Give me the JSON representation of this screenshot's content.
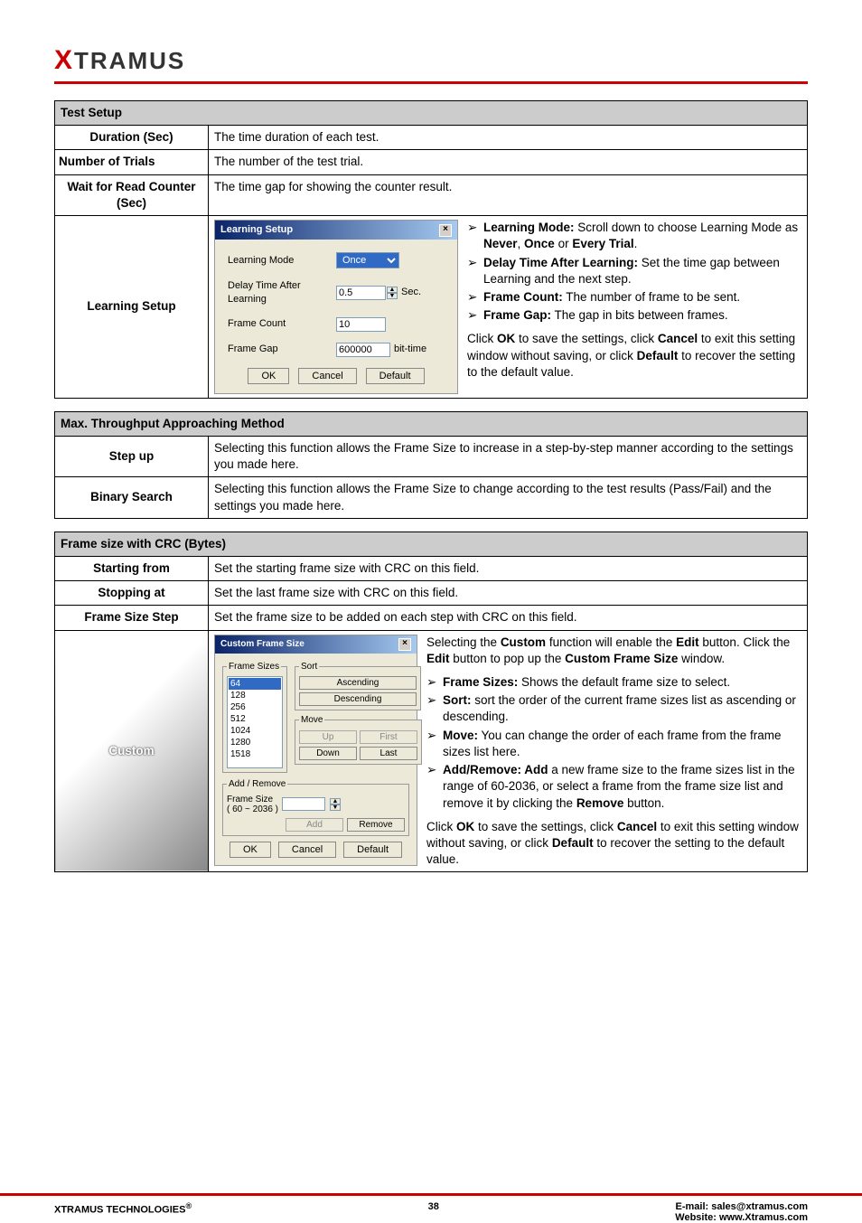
{
  "brand": {
    "x": "X",
    "rest": "TRAMUS"
  },
  "table1": {
    "header": "Test Setup",
    "rows": [
      {
        "label": "Duration (Sec)",
        "desc": "The time duration of each test."
      },
      {
        "label": "Number of Trials",
        "desc": "The number of the test trial."
      },
      {
        "label": "Wait for Read Counter (Sec)",
        "desc": "The time gap for showing the counter result."
      }
    ],
    "learning": {
      "label": "Learning Setup",
      "dialog": {
        "title": "Learning Setup",
        "r1lbl": "Learning Mode",
        "r1val": "Once",
        "r2lbl": "Delay Time After Learning",
        "r2val": "0.5",
        "r2unit": "Sec.",
        "r3lbl": "Frame Count",
        "r3val": "10",
        "r4lbl": "Frame Gap",
        "r4val": "600000",
        "r4unit": "bit-time",
        "btnOK": "OK",
        "btnCancel": "Cancel",
        "btnDefault": "Default"
      },
      "desc": {
        "b1a": "Learning Mode:",
        "b1b": " Scroll down to choose Learning Mode as ",
        "b1c": "Never",
        "b1d": ", ",
        "b1e": "Once",
        "b1f": " or ",
        "b1g": "Every Trial",
        "b1h": ".",
        "b2a": "Delay Time After Learning:",
        "b2b": " Set the time gap between Learning and the next step.",
        "b3a": "Frame Count:",
        "b3b": " The number of frame to be sent.",
        "b4a": "Frame Gap:",
        "b4b": " The gap in bits between frames.",
        "tail1": "Click ",
        "tail2": "OK",
        "tail3": " to save the settings, click ",
        "tail4": "Cancel",
        "tail5": " to exit this setting window without saving, or click ",
        "tail6": "Default",
        "tail7": " to recover the setting to the default value."
      }
    }
  },
  "table2": {
    "header": "Max. Throughput Approaching Method",
    "r1lbl": "Step up",
    "r1desc": "Selecting this function allows the Frame Size to increase in a step-by-step manner according to the settings you made here.",
    "r2lbl": "Binary Search",
    "r2desc": "Selecting this function allows the Frame Size to change according to the test results (Pass/Fail) and the settings you made here."
  },
  "table3": {
    "header": "Frame size with CRC (Bytes)",
    "r1lbl": "Starting from",
    "r1desc": "Set the starting frame size with CRC on this field.",
    "r2lbl": "Stopping at",
    "r2desc": "Set the last frame size with CRC on this field.",
    "r3lbl": "Frame Size Step",
    "r3desc": "Set the frame size to be added on each step with CRC on this field.",
    "custom": {
      "label": "Custom",
      "dialog": {
        "title": "Custom Frame Size",
        "leg1": "Frame Sizes",
        "leg2": "Sort",
        "leg3": "Move",
        "leg4": "Add / Remove",
        "items": [
          "64",
          "128",
          "256",
          "512",
          "1024",
          "1280",
          "1518"
        ],
        "btnAsc": "Ascending",
        "btnDesc": "Descending",
        "btnUp": "Up",
        "btnFirst": "First",
        "btnDown": "Down",
        "btnLast": "Last",
        "lblFrameSize": "Frame Size",
        "lblRange": "( 60 ~ 2036 )",
        "btnAdd": "Add",
        "btnRemove": "Remove",
        "btnOK": "OK",
        "btnCancel": "Cancel",
        "btnDefault": "Default"
      },
      "desc": {
        "intro1": "Selecting the ",
        "intro2": "Custom",
        "intro3": " function will enable the ",
        "intro4": "Edit",
        "intro5": " button. Click the ",
        "intro6": "Edit",
        "intro7": " button to pop up the ",
        "intro8": "Custom Frame Size",
        "intro9": " window.",
        "b1a": "Frame Sizes:",
        "b1b": " Shows the default frame size to select.",
        "b2a": "Sort:",
        "b2b": " sort the order of the current frame sizes list as ascending or descending.",
        "b3a": "Move:",
        "b3b": " You can change the order of each frame from the frame sizes list here.",
        "b4a": "Add/Remove: Add",
        "b4b": " a new frame size to the frame sizes list in the range of 60-2036, or select a frame from the frame size list and remove it by clicking the ",
        "b4c": "Remove",
        "b4d": " button.",
        "tail1": "Click ",
        "tail2": "OK",
        "tail3": " to save the settings, click ",
        "tail4": "Cancel",
        "tail5": " to exit this setting window without saving, or click ",
        "tail6": "Default",
        "tail7": " to recover the setting to the default value."
      }
    }
  },
  "footer": {
    "left": "XTRAMUS TECHNOLOGIES",
    "reg": "®",
    "page": "38",
    "email_lbl": "E-mail: ",
    "email": "sales@xtramus.com",
    "web_lbl": "Website:  ",
    "web": "www.Xtramus.com"
  }
}
